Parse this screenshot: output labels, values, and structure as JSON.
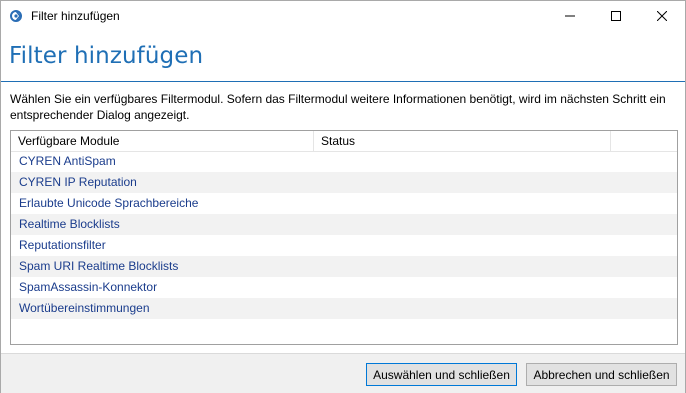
{
  "window": {
    "title": "Filter hinzufügen"
  },
  "header": {
    "title": "Filter hinzufügen"
  },
  "description": "Wählen Sie ein verfügbares Filtermodul. Sofern das Filtermodul weitere Informationen benötigt, wird im nächsten Schritt ein entsprechender Dialog angezeigt.",
  "list": {
    "columns": [
      "Verfügbare Module",
      "Status",
      ""
    ],
    "rows": [
      {
        "name": "CYREN AntiSpam",
        "status": ""
      },
      {
        "name": "CYREN IP Reputation",
        "status": ""
      },
      {
        "name": "Erlaubte Unicode Sprachbereiche",
        "status": ""
      },
      {
        "name": "Realtime Blocklists",
        "status": ""
      },
      {
        "name": "Reputationsfilter",
        "status": ""
      },
      {
        "name": "Spam URI Realtime Blocklists",
        "status": ""
      },
      {
        "name": "SpamAssassin-Konnektor",
        "status": ""
      },
      {
        "name": "Wortübereinstimmungen",
        "status": ""
      }
    ]
  },
  "buttons": {
    "select_close": "Auswählen und schließen",
    "cancel_close": "Abbrechen und schließen"
  },
  "icons": {
    "app": "app-icon",
    "minimize": "minimize-icon",
    "maximize": "maximize-icon",
    "close": "close-icon"
  },
  "colors": {
    "accent": "#1f6fb5",
    "item_text": "#1a3c8c"
  }
}
